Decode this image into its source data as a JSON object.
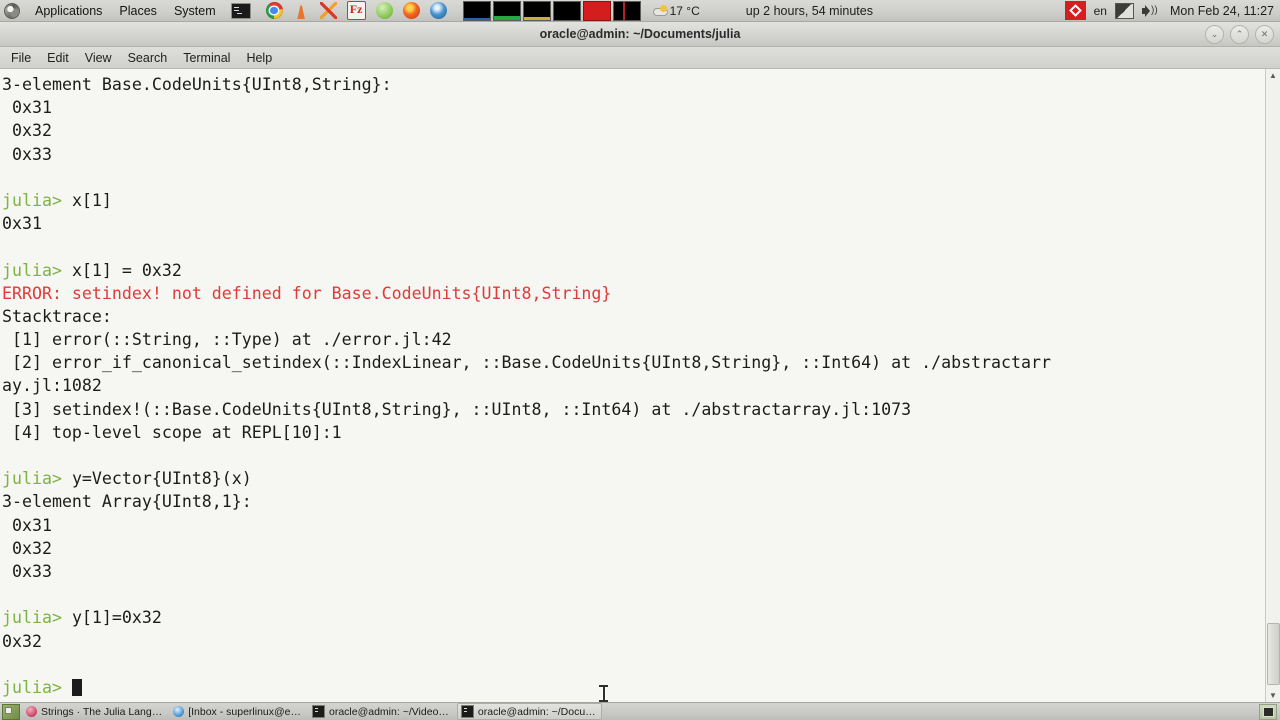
{
  "top_panel": {
    "menus": [
      "Applications",
      "Places",
      "System"
    ],
    "logo_icon": "gnome-foot-icon",
    "launcher_icon": "terminal-icon",
    "tray_apps": [
      {
        "name": "chrome-icon",
        "label": "Google Chrome"
      },
      {
        "name": "vlc-icon",
        "label": "VLC Media Player"
      },
      {
        "name": "xflux-icon",
        "label": "Xflux"
      },
      {
        "name": "filezilla-icon",
        "label": "FileZilla",
        "glyph": "Fz"
      },
      {
        "name": "green-app-icon",
        "label": "Green App"
      },
      {
        "name": "firefox-icon",
        "label": "Firefox"
      },
      {
        "name": "blue-swirl-icon",
        "label": "Blue App"
      }
    ],
    "monitors": [
      "net-monitor",
      "cpu-monitor",
      "disk-monitor",
      "mem-monitor",
      "load-monitor",
      "swap-monitor"
    ],
    "weather": {
      "icon": "cloud-sun-icon",
      "temperature": "17 °C"
    },
    "uptime": "up 2 hours, 54 minutes",
    "indicator_icon": "red-diamond-icon",
    "keyboard_layout": "en",
    "display_icon": "display-icon",
    "volume_icon": "volume-icon",
    "clock": "Mon Feb 24, 11:27"
  },
  "window": {
    "title": "oracle@admin: ~/Documents/julia",
    "buttons": [
      {
        "name": "minimize-button",
        "glyph": "⌄"
      },
      {
        "name": "maximize-button",
        "glyph": "⌃"
      },
      {
        "name": "close-button",
        "glyph": "✕"
      }
    ],
    "menubar": [
      "File",
      "Edit",
      "View",
      "Search",
      "Terminal",
      "Help"
    ]
  },
  "terminal": {
    "lines": [
      {
        "type": "out",
        "text": "3-element Base.CodeUnits{UInt8,String}:"
      },
      {
        "type": "out",
        "text": " 0x31"
      },
      {
        "type": "out",
        "text": " 0x32"
      },
      {
        "type": "out",
        "text": " 0x33"
      },
      {
        "type": "out",
        "text": ""
      },
      {
        "type": "cmd",
        "prompt": "julia> ",
        "text": "x[1]"
      },
      {
        "type": "out",
        "text": "0x31"
      },
      {
        "type": "out",
        "text": ""
      },
      {
        "type": "cmd",
        "prompt": "julia> ",
        "text": "x[1] = 0x32"
      },
      {
        "type": "err",
        "text": "ERROR: setindex! not defined for Base.CodeUnits{UInt8,String}"
      },
      {
        "type": "out",
        "text": "Stacktrace:"
      },
      {
        "type": "out",
        "text": " [1] error(::String, ::Type) at ./error.jl:42"
      },
      {
        "type": "out",
        "text": " [2] error_if_canonical_setindex(::IndexLinear, ::Base.CodeUnits{UInt8,String}, ::Int64) at ./abstractarr"
      },
      {
        "type": "out",
        "text": "ay.jl:1082"
      },
      {
        "type": "out",
        "text": " [3] setindex!(::Base.CodeUnits{UInt8,String}, ::UInt8, ::Int64) at ./abstractarray.jl:1073"
      },
      {
        "type": "out",
        "text": " [4] top-level scope at REPL[10]:1"
      },
      {
        "type": "out",
        "text": ""
      },
      {
        "type": "cmd",
        "prompt": "julia> ",
        "text": "y=Vector{UInt8}(x)"
      },
      {
        "type": "out",
        "text": "3-element Array{UInt8,1}:"
      },
      {
        "type": "out",
        "text": " 0x31"
      },
      {
        "type": "out",
        "text": " 0x32"
      },
      {
        "type": "out",
        "text": " 0x33"
      },
      {
        "type": "out",
        "text": ""
      },
      {
        "type": "cmd",
        "prompt": "julia> ",
        "text": "y[1]=0x32"
      },
      {
        "type": "out",
        "text": "0x32"
      },
      {
        "type": "out",
        "text": ""
      },
      {
        "type": "cursor",
        "prompt": "julia> ",
        "text": ""
      }
    ],
    "colors": {
      "background": "#f6f6f2",
      "foreground": "#1c1c1c",
      "prompt_green": "#7cb342",
      "error_red": "#e03a3a"
    },
    "scrollbar": {
      "up_glyph": "▲",
      "down_glyph": "▼"
    }
  },
  "taskbar": {
    "show_desktop_icon": "show-desktop-icon",
    "tasks": [
      {
        "icon": "julia-icon",
        "label": "Strings · The Julia Lang…",
        "active": false
      },
      {
        "icon": "thunderbird-icon",
        "label": "[Inbox - superlinux@e…",
        "active": false
      },
      {
        "icon": "terminal-icon",
        "label": "oracle@admin: ~/Video…",
        "active": false
      },
      {
        "icon": "terminal-icon",
        "label": "oracle@admin: ~/Docu…",
        "active": true
      }
    ],
    "workspace_switcher": "workspace-switcher"
  }
}
